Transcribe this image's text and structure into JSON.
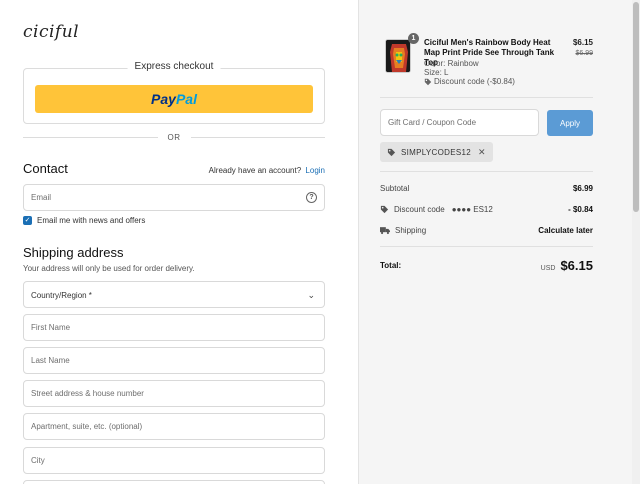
{
  "brand": {
    "logo_text": "ciciful"
  },
  "express": {
    "title": "Express checkout",
    "paypal_a": "Pay",
    "paypal_b": "Pal"
  },
  "divider": {
    "or": "OR"
  },
  "contact": {
    "title": "Contact",
    "have_account": "Already have an account?",
    "login": "Login",
    "email_placeholder": "Email",
    "help_glyph": "?",
    "newsletter_label": "Email me with news and offers",
    "newsletter_checked": true
  },
  "shipping": {
    "title": "Shipping address",
    "subtitle": "Your address will only be used for order delivery.",
    "country_label": "Country/Region *",
    "first_name": "First Name",
    "last_name": "Last Name",
    "street": "Street address & house number",
    "apartment": "Apartment, suite, etc. (optional)",
    "city": "City"
  },
  "cart": {
    "item": {
      "qty": "1",
      "title": "Ciciful Men's Rainbow Body Heat Map Print Pride See Through Tank Top",
      "color": "Color: Rainbow",
      "size": "Size: L",
      "discount": "Discount code (-$0.84)",
      "price": "$6.15",
      "original_price": "$6.99"
    },
    "coupon_placeholder": "Gift Card / Coupon Code",
    "apply_label": "Apply",
    "applied_code": "SIMPLYCODES12",
    "subtotal_label": "Subtotal",
    "subtotal_value": "$6.99",
    "discount_label": "Discount code",
    "discount_code_mask": "●●●● ES12",
    "discount_value": "- $0.84",
    "shipping_label": "Shipping",
    "shipping_value": "Calculate later",
    "total_label": "Total:",
    "currency": "USD",
    "total_value": "$6.15"
  },
  "icons": {
    "tag": "tag-icon",
    "truck": "truck-icon",
    "close": "close-icon",
    "chevron": "chevron-down-icon",
    "help": "help-circle-icon",
    "check": "checkmark-icon"
  },
  "colors": {
    "paypal_yellow": "#ffc439",
    "link_blue": "#1b6fb5",
    "apply_blue": "#5b9bd5"
  }
}
